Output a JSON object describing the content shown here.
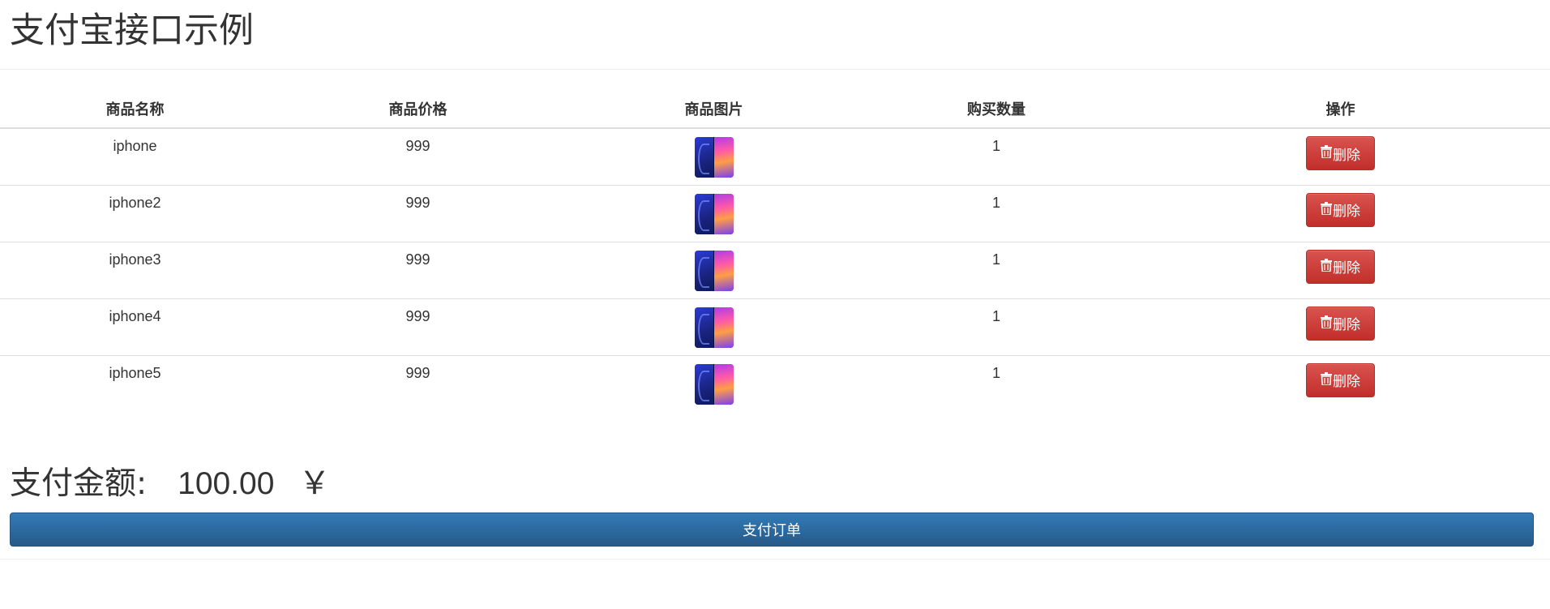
{
  "page": {
    "title": "支付宝接口示例"
  },
  "table": {
    "headers": [
      "商品名称",
      "商品价格",
      "商品图片",
      "购买数量",
      "操作"
    ],
    "rows": [
      {
        "name": "iphone",
        "price": "999",
        "image_icon": "phone-product-image",
        "quantity": "1",
        "action_label": "删除"
      },
      {
        "name": "iphone2",
        "price": "999",
        "image_icon": "phone-product-image",
        "quantity": "1",
        "action_label": "删除"
      },
      {
        "name": "iphone3",
        "price": "999",
        "image_icon": "phone-product-image",
        "quantity": "1",
        "action_label": "删除"
      },
      {
        "name": "iphone4",
        "price": "999",
        "image_icon": "phone-product-image",
        "quantity": "1",
        "action_label": "删除"
      },
      {
        "name": "iphone5",
        "price": "999",
        "image_icon": "phone-product-image",
        "quantity": "1",
        "action_label": "删除"
      }
    ]
  },
  "payment": {
    "amount_label": "支付金额:",
    "amount_value": "100.00",
    "currency_symbol": "￥",
    "pay_button_label": "支付订单"
  },
  "colors": {
    "danger": "#d9534f",
    "primary": "#337ab7",
    "text": "#333333",
    "border": "#dddddd"
  }
}
